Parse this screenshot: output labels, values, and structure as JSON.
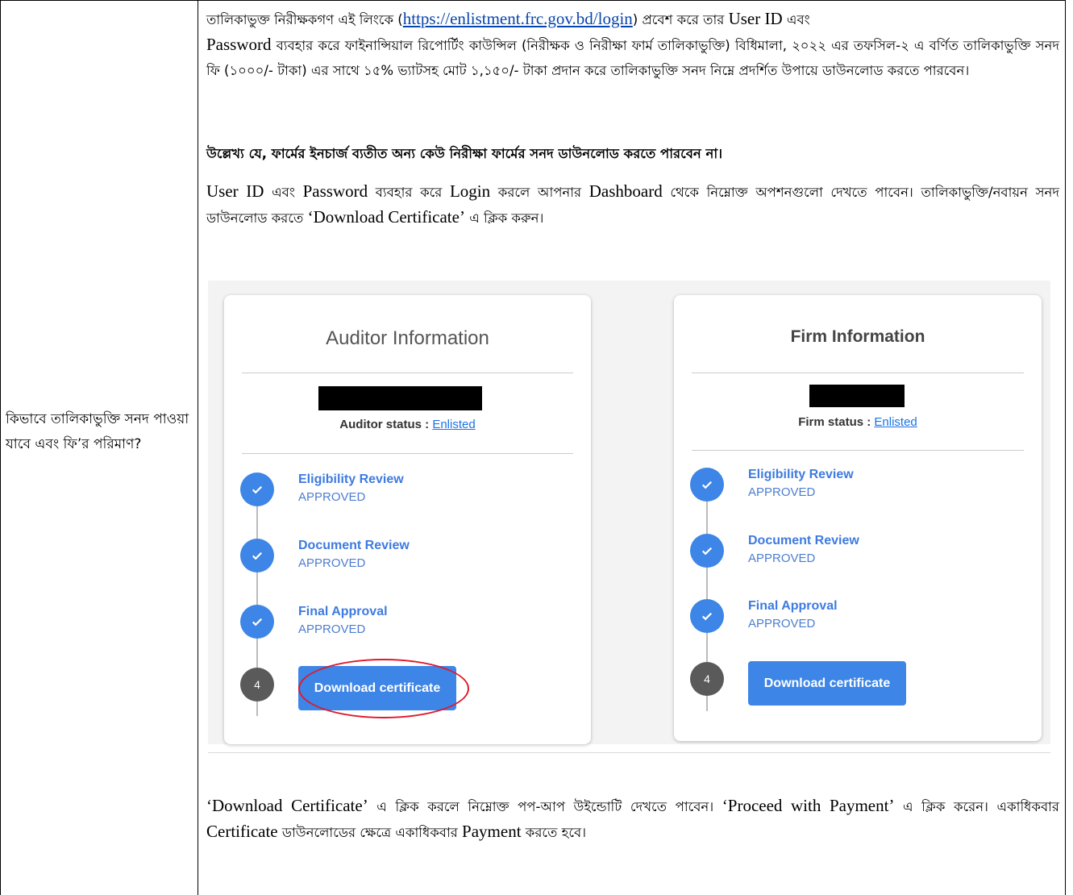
{
  "left_cell": {
    "question": "কিভাবে তালিকাভুক্তি সনদ পাওয়া যাবে এবং ফি’র পরিমাণ?"
  },
  "para1": {
    "a": "তালিকাভুক্ত নিরীক্ষকগণ এই লিংকে (",
    "link": "https://enlistment.frc.gov.bd/login",
    "b": ") প্রবেশ করে তার ",
    "c": "User ID",
    "d": " এবং ",
    "e": "Password",
    "f": " ব্যবহার করে ফাইনান্সিয়াল রিপোর্টিং কাউন্সিল (নিরীক্ষক ও নিরীক্ষা ফার্ম তালিকাভুক্তি) বিধিমালা, ২০২২ এর তফসিল-২ এ বর্ণিত তালিকাভুক্তি সনদ ফি (১০০০/- টাকা) এর সাথে ১৫% ভ্যাটসহ মোট ১,১৫০/- টাকা প্রদান করে তালিকাভুক্তি সনদ নিম্নে প্রদর্শিত উপায়ে ডাউনলোড করতে পারবেন।"
  },
  "para2": "উল্লেখ্য যে, ফার্মের ইনচার্জ ব্যতীত অন্য কেউ নিরীক্ষা ফার্মের সনদ ডাউনলোড করতে পারবেন না।",
  "para3": {
    "a": "User ID",
    "b": " এবং ",
    "c": "Password",
    "d": " ব্যবহার করে ",
    "e": "Login",
    "f": " করলে আপনার ",
    "g": "Dashboard",
    "h": " থেকে নিম্নোক্ত অপশনগুলো দেখতে পাবেন। তালিকাভুক্তি/নবায়ন সনদ ডাউনলোড করতে ",
    "i": "‘Download Certificate’",
    "j": " এ ক্লিক করুন।"
  },
  "para4": {
    "a": "‘Download Certificate’",
    "b": " এ ক্লিক করলে নিম্নোক্ত পপ-আপ উইন্ডোটি দেখতে পাবেন। ",
    "c": "‘Proceed with Payment’",
    "d": " এ ক্লিক করেন। একাধিকবার ",
    "e": "Certificate",
    "f": " ডাউনলোডের ক্ষেত্রে একাধিকবার ",
    "g": "Payment",
    "h": " করতে হবে।"
  },
  "auditor_card": {
    "title": "Auditor Information",
    "status_label": "Auditor status :",
    "status_value": "Enlisted",
    "steps": [
      {
        "title": "Eligibility Review",
        "status": "APPROVED"
      },
      {
        "title": "Document Review",
        "status": "APPROVED"
      },
      {
        "title": "Final Approval",
        "status": "APPROVED"
      }
    ],
    "step4_number": "4",
    "button_label": "Download certificate"
  },
  "firm_card": {
    "title": "Firm Information",
    "status_label": "Firm status :",
    "status_value": "Enlisted",
    "steps": [
      {
        "title": "Eligibility Review",
        "status": "APPROVED"
      },
      {
        "title": "Document Review",
        "status": "APPROVED"
      },
      {
        "title": "Final Approval",
        "status": "APPROVED"
      }
    ],
    "step4_number": "4",
    "button_label": "Download certificate"
  },
  "colors": {
    "accent": "#3d85e6",
    "highlight_ellipse": "#e0182a",
    "link": "#0645ad"
  }
}
